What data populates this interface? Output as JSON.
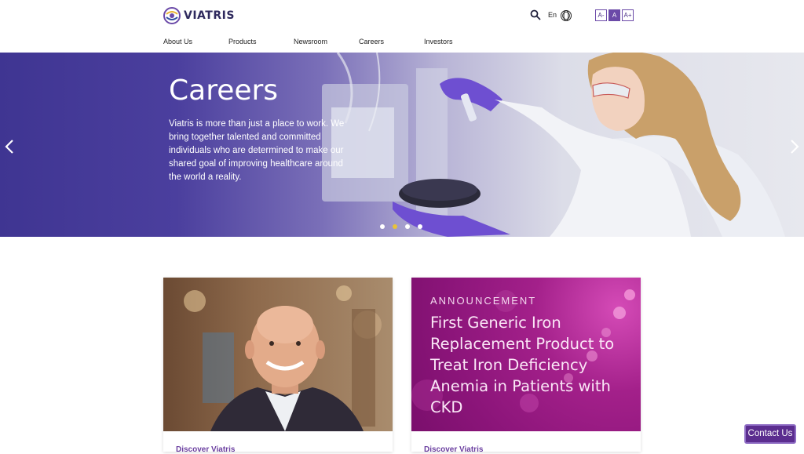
{
  "brand": {
    "name": "VIATRIS"
  },
  "header": {
    "language": "En",
    "text_size_buttons": [
      "A-",
      "A",
      "A+"
    ]
  },
  "nav": {
    "items": [
      {
        "label": "About Us"
      },
      {
        "label": "Products"
      },
      {
        "label": "Newsroom"
      },
      {
        "label": "Careers"
      },
      {
        "label": "Investors"
      }
    ]
  },
  "hero": {
    "title": "Careers",
    "text": "Viatris is more than just a place to work. We bring together talented and committed individuals who are determined to make our shared goal of improving healthcare around the world a reality.",
    "slide_count": 4,
    "active_slide": 2
  },
  "cards": [
    {
      "link_label": "Discover Viatris"
    },
    {
      "kicker": "ANNOUNCEMENT",
      "title": "First Generic Iron Replacement Product to Treat Iron Deficiency Anemia in Patients with CKD",
      "link_label": "Discover Viatris"
    }
  ],
  "contact": {
    "label": "Contact Us"
  },
  "colors": {
    "brand_purple": "#5b2d8f",
    "hero_purple": "#3f3592",
    "announcement_magenta": "#a3208a",
    "active_dot": "#e8c23a"
  },
  "icons": [
    "search-icon",
    "globe-icon",
    "chevron-left-icon",
    "chevron-right-icon",
    "viatris-logo-icon"
  ]
}
